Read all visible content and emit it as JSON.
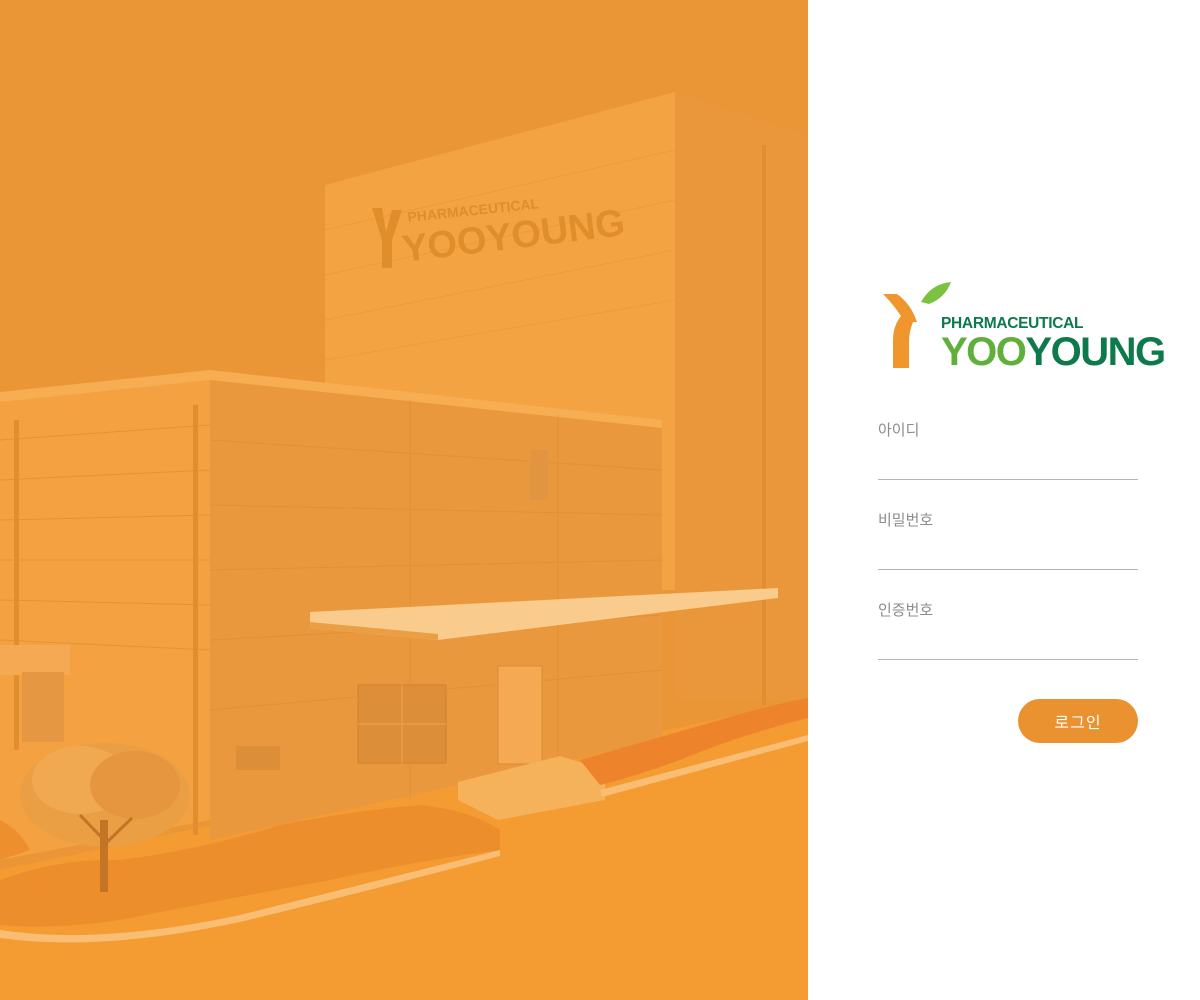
{
  "hero": {
    "sign_subtitle": "PHARMACEUTICAL",
    "sign_name": "YOOYOUNG"
  },
  "brand": {
    "subtitle": "PHARMACEUTICAL",
    "name_part1": "YOO",
    "name_part2": "YOUNG",
    "colors": {
      "orange": "#f0962e",
      "leaf": "#7cc242",
      "green_dark": "#0c7a4a",
      "green_light": "#5fb03a"
    }
  },
  "form": {
    "id_label": "아이디",
    "id_value": "",
    "password_label": "비밀번호",
    "password_value": "",
    "auth_label": "인증번호",
    "auth_value": "",
    "login_button": "로그인"
  },
  "theme": {
    "accent": "#ea9130",
    "hero_tint": "#f09a34"
  }
}
